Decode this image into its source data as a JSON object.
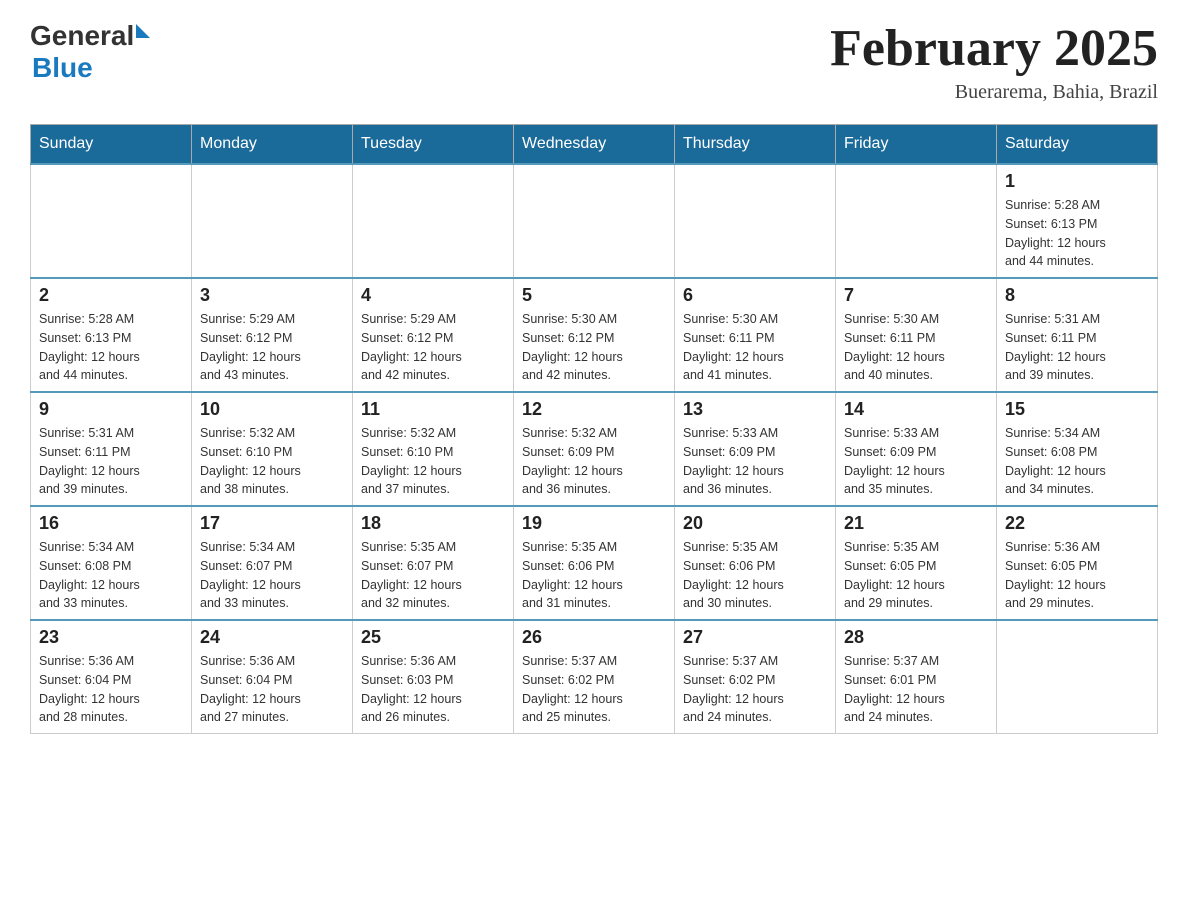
{
  "header": {
    "logo_general": "General",
    "logo_blue": "Blue",
    "month_title": "February 2025",
    "subtitle": "Buerarema, Bahia, Brazil"
  },
  "days_of_week": [
    "Sunday",
    "Monday",
    "Tuesday",
    "Wednesday",
    "Thursday",
    "Friday",
    "Saturday"
  ],
  "weeks": [
    {
      "days": [
        {
          "num": "",
          "info": ""
        },
        {
          "num": "",
          "info": ""
        },
        {
          "num": "",
          "info": ""
        },
        {
          "num": "",
          "info": ""
        },
        {
          "num": "",
          "info": ""
        },
        {
          "num": "",
          "info": ""
        },
        {
          "num": "1",
          "info": "Sunrise: 5:28 AM\nSunset: 6:13 PM\nDaylight: 12 hours\nand 44 minutes."
        }
      ]
    },
    {
      "days": [
        {
          "num": "2",
          "info": "Sunrise: 5:28 AM\nSunset: 6:13 PM\nDaylight: 12 hours\nand 44 minutes."
        },
        {
          "num": "3",
          "info": "Sunrise: 5:29 AM\nSunset: 6:12 PM\nDaylight: 12 hours\nand 43 minutes."
        },
        {
          "num": "4",
          "info": "Sunrise: 5:29 AM\nSunset: 6:12 PM\nDaylight: 12 hours\nand 42 minutes."
        },
        {
          "num": "5",
          "info": "Sunrise: 5:30 AM\nSunset: 6:12 PM\nDaylight: 12 hours\nand 42 minutes."
        },
        {
          "num": "6",
          "info": "Sunrise: 5:30 AM\nSunset: 6:11 PM\nDaylight: 12 hours\nand 41 minutes."
        },
        {
          "num": "7",
          "info": "Sunrise: 5:30 AM\nSunset: 6:11 PM\nDaylight: 12 hours\nand 40 minutes."
        },
        {
          "num": "8",
          "info": "Sunrise: 5:31 AM\nSunset: 6:11 PM\nDaylight: 12 hours\nand 39 minutes."
        }
      ]
    },
    {
      "days": [
        {
          "num": "9",
          "info": "Sunrise: 5:31 AM\nSunset: 6:11 PM\nDaylight: 12 hours\nand 39 minutes."
        },
        {
          "num": "10",
          "info": "Sunrise: 5:32 AM\nSunset: 6:10 PM\nDaylight: 12 hours\nand 38 minutes."
        },
        {
          "num": "11",
          "info": "Sunrise: 5:32 AM\nSunset: 6:10 PM\nDaylight: 12 hours\nand 37 minutes."
        },
        {
          "num": "12",
          "info": "Sunrise: 5:32 AM\nSunset: 6:09 PM\nDaylight: 12 hours\nand 36 minutes."
        },
        {
          "num": "13",
          "info": "Sunrise: 5:33 AM\nSunset: 6:09 PM\nDaylight: 12 hours\nand 36 minutes."
        },
        {
          "num": "14",
          "info": "Sunrise: 5:33 AM\nSunset: 6:09 PM\nDaylight: 12 hours\nand 35 minutes."
        },
        {
          "num": "15",
          "info": "Sunrise: 5:34 AM\nSunset: 6:08 PM\nDaylight: 12 hours\nand 34 minutes."
        }
      ]
    },
    {
      "days": [
        {
          "num": "16",
          "info": "Sunrise: 5:34 AM\nSunset: 6:08 PM\nDaylight: 12 hours\nand 33 minutes."
        },
        {
          "num": "17",
          "info": "Sunrise: 5:34 AM\nSunset: 6:07 PM\nDaylight: 12 hours\nand 33 minutes."
        },
        {
          "num": "18",
          "info": "Sunrise: 5:35 AM\nSunset: 6:07 PM\nDaylight: 12 hours\nand 32 minutes."
        },
        {
          "num": "19",
          "info": "Sunrise: 5:35 AM\nSunset: 6:06 PM\nDaylight: 12 hours\nand 31 minutes."
        },
        {
          "num": "20",
          "info": "Sunrise: 5:35 AM\nSunset: 6:06 PM\nDaylight: 12 hours\nand 30 minutes."
        },
        {
          "num": "21",
          "info": "Sunrise: 5:35 AM\nSunset: 6:05 PM\nDaylight: 12 hours\nand 29 minutes."
        },
        {
          "num": "22",
          "info": "Sunrise: 5:36 AM\nSunset: 6:05 PM\nDaylight: 12 hours\nand 29 minutes."
        }
      ]
    },
    {
      "days": [
        {
          "num": "23",
          "info": "Sunrise: 5:36 AM\nSunset: 6:04 PM\nDaylight: 12 hours\nand 28 minutes."
        },
        {
          "num": "24",
          "info": "Sunrise: 5:36 AM\nSunset: 6:04 PM\nDaylight: 12 hours\nand 27 minutes."
        },
        {
          "num": "25",
          "info": "Sunrise: 5:36 AM\nSunset: 6:03 PM\nDaylight: 12 hours\nand 26 minutes."
        },
        {
          "num": "26",
          "info": "Sunrise: 5:37 AM\nSunset: 6:02 PM\nDaylight: 12 hours\nand 25 minutes."
        },
        {
          "num": "27",
          "info": "Sunrise: 5:37 AM\nSunset: 6:02 PM\nDaylight: 12 hours\nand 24 minutes."
        },
        {
          "num": "28",
          "info": "Sunrise: 5:37 AM\nSunset: 6:01 PM\nDaylight: 12 hours\nand 24 minutes."
        },
        {
          "num": "",
          "info": ""
        }
      ]
    }
  ]
}
